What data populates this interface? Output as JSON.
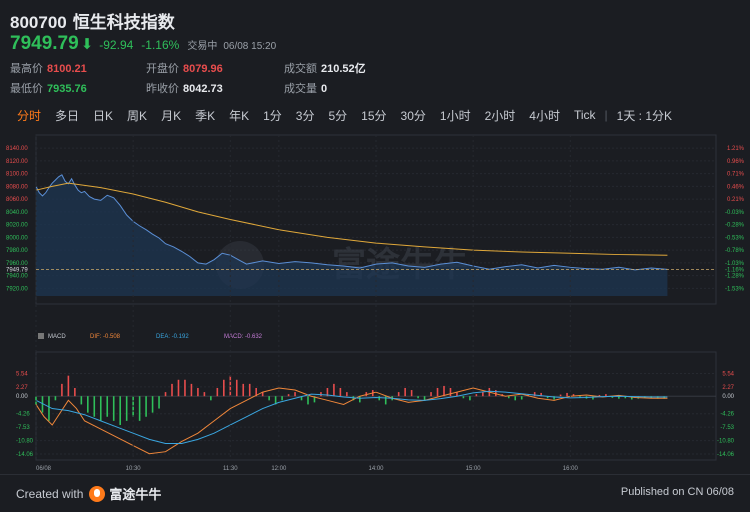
{
  "header": {
    "code": "800700",
    "name": "恒生科技指数",
    "price": "7949.79",
    "change": "-92.94",
    "change_pct": "-1.16%",
    "status": "交易中",
    "datetime": "06/08 15:20",
    "high_label": "最高价",
    "high": "8100.21",
    "low_label": "最低价",
    "low": "7935.76",
    "open_label": "开盘价",
    "open": "8079.96",
    "prev_label": "昨收价",
    "prev": "8042.73",
    "turnover_label": "成交额",
    "turnover": "210.52亿",
    "volume_label": "成交量",
    "volume": "0"
  },
  "tabs": [
    "分时",
    "多日",
    "日K",
    "周K",
    "月K",
    "季K",
    "年K",
    "1分",
    "3分",
    "5分",
    "15分",
    "30分",
    "1小时",
    "2小时",
    "4小时",
    "Tick"
  ],
  "tab_extra": "1天 : 1分K",
  "watermark": "富途牛牛",
  "macd_legend": {
    "name": "MACD",
    "dif": "DIF: -0.508",
    "dea": "DEA: -0.192",
    "macd": "MACD: -0.632"
  },
  "footer": {
    "created": "Created with",
    "brand": "富途牛牛",
    "published": "Published on CN 06/08"
  },
  "colors": {
    "up": "#e84d4d",
    "down": "#2fbf5a",
    "price_line": "#5b8fd6",
    "avg_line": "#e0a83a",
    "dif": "#f0873a",
    "dea": "#3aa6e0",
    "active_tab": "#ff7a1a"
  },
  "chart_data": {
    "type": "line",
    "price_axis": {
      "ticks": [
        "8140.00",
        "8120.00",
        "8100.00",
        "8080.00",
        "8060.00",
        "8040.00",
        "8020.00",
        "8000.00",
        "7980.00",
        "7960.00",
        "7949.79",
        "7940.00",
        "7920.00"
      ],
      "ylim": [
        7908,
        8148
      ]
    },
    "pct_axis": {
      "ticks": [
        "1.21%",
        "0.96%",
        "0.71%",
        "0.46%",
        "0.21%",
        "-0.03%",
        "-0.28%",
        "-0.53%",
        "-0.78%",
        "-1.03%",
        "-1.16%",
        "-1.28%",
        "-1.53%"
      ]
    },
    "time_ticks": [
      "06/08",
      "10:30",
      "11:30",
      "12:00",
      "14:00",
      "15:00",
      "16:00"
    ],
    "price": {
      "name": "price",
      "t": [
        0,
        2,
        4,
        6,
        8,
        10,
        12,
        14,
        16,
        18,
        20,
        22,
        24,
        26,
        28,
        30,
        33,
        36,
        40,
        44,
        48,
        52,
        56,
        60,
        64,
        68,
        72,
        76,
        80,
        85,
        90,
        95,
        100,
        105,
        110,
        115,
        120,
        125,
        130,
        140,
        150,
        160,
        170,
        180,
        190,
        200,
        210,
        220,
        230,
        240,
        250,
        260,
        270,
        280,
        290,
        300,
        310,
        320,
        330,
        340,
        350,
        360,
        370,
        380,
        390
      ],
      "v": [
        8080,
        8070,
        8065,
        8070,
        8078,
        8085,
        8090,
        8095,
        8098,
        8088,
        8084,
        8092,
        8082,
        8074,
        8070,
        8072,
        8064,
        8060,
        8058,
        8066,
        8062,
        8050,
        8035,
        8025,
        8018,
        8012,
        8005,
        7999,
        7990,
        7985,
        7978,
        7970,
        7960,
        7958,
        7965,
        7975,
        7972,
        7965,
        7958,
        7963,
        7959,
        7962,
        7960,
        7957,
        7955,
        7952,
        7958,
        7960,
        7955,
        7953,
        7958,
        7961,
        7955,
        7950,
        7954,
        7957,
        7952,
        7956,
        7953,
        7951,
        7950,
        7953,
        7949,
        7952,
        7949.79
      ]
    },
    "average": {
      "name": "average",
      "t": [
        0,
        10,
        20,
        40,
        60,
        80,
        100,
        120,
        150,
        180,
        210,
        240,
        270,
        300,
        330,
        360,
        390
      ],
      "v": [
        8074,
        8080,
        8085,
        8078,
        8068,
        8055,
        8040,
        8028,
        8012,
        8000,
        7991,
        7985,
        7980,
        7977,
        7975,
        7973,
        7972
      ]
    },
    "macd_axis": {
      "ticks": [
        "5.54",
        "2.27",
        "0.00",
        "-4.26",
        "-7.53",
        "-10.80",
        "-14.06"
      ],
      "ylim": [
        -14.06,
        8.81
      ]
    },
    "dif": {
      "t": [
        0,
        5,
        10,
        15,
        20,
        25,
        30,
        40,
        50,
        60,
        70,
        80,
        90,
        100,
        110,
        120,
        130,
        140,
        150,
        160,
        170,
        180,
        190,
        200,
        210,
        220,
        230,
        240,
        250,
        260,
        270,
        280,
        290,
        300,
        310,
        320,
        330,
        340,
        350,
        360,
        370,
        380,
        390
      ],
      "v": [
        -2,
        -5,
        -7,
        -4,
        -1,
        -3,
        -6,
        -8,
        -10,
        -12,
        -14,
        -13.5,
        -11,
        -9,
        -6,
        -3,
        -1,
        1,
        2,
        1.5,
        0,
        -1,
        -2,
        0,
        1,
        -0.5,
        -1.5,
        -1,
        0,
        1,
        2,
        1,
        0,
        0.5,
        -0.5,
        -1,
        0,
        0.3,
        -0.2,
        0.2,
        -0.3,
        -0.5,
        -0.5
      ]
    },
    "dea": {
      "t": [
        0,
        10,
        20,
        30,
        40,
        50,
        60,
        70,
        80,
        90,
        100,
        110,
        120,
        130,
        140,
        150,
        160,
        170,
        180,
        190,
        200,
        210,
        220,
        230,
        240,
        250,
        260,
        270,
        280,
        290,
        300,
        310,
        320,
        330,
        340,
        350,
        360,
        370,
        380,
        390
      ],
      "v": [
        -1,
        -3,
        -3.5,
        -4.5,
        -6,
        -7.5,
        -9,
        -10.5,
        -11.5,
        -11.5,
        -10.5,
        -9,
        -7,
        -5,
        -3,
        -1.5,
        -0.5,
        0.5,
        0.3,
        -0.2,
        -0.5,
        -0.3,
        -0.5,
        -0.9,
        -1,
        -0.6,
        0,
        0.8,
        1.2,
        1,
        0.6,
        0.2,
        -0.2,
        -0.4,
        -0.3,
        -0.1,
        0,
        -0.1,
        -0.2,
        -0.2
      ]
    },
    "macd_bars": {
      "t": [
        0,
        4,
        8,
        12,
        16,
        20,
        24,
        28,
        32,
        36,
        40,
        44,
        48,
        52,
        56,
        60,
        64,
        68,
        72,
        76,
        80,
        84,
        88,
        92,
        96,
        100,
        104,
        108,
        112,
        116,
        120,
        124,
        128,
        132,
        136,
        140,
        144,
        148,
        152,
        156,
        160,
        164,
        168,
        172,
        176,
        180,
        184,
        188,
        192,
        196,
        200,
        204,
        208,
        212,
        216,
        220,
        224,
        228,
        232,
        236,
        240,
        244,
        248,
        252,
        256,
        260,
        264,
        268,
        272,
        276,
        280,
        284,
        288,
        292,
        296,
        300,
        304,
        308,
        312,
        316,
        320,
        324,
        328,
        332,
        336,
        340,
        344,
        348,
        352,
        356,
        360,
        364,
        368,
        372,
        376,
        380,
        384,
        388
      ],
      "v": [
        -2,
        -4,
        -6,
        -1,
        3,
        5,
        2,
        -2,
        -4,
        -5,
        -6,
        -5,
        -6,
        -7,
        -6,
        -5,
        -6,
        -5,
        -4,
        -3,
        1,
        3,
        4,
        4,
        3,
        2,
        1,
        -1,
        2,
        4,
        5,
        4,
        3,
        3,
        2,
        1,
        -1,
        -2,
        -1,
        0.5,
        1,
        -1,
        -2,
        -1.5,
        1,
        2,
        3,
        2,
        1,
        -1,
        -1.5,
        1,
        1.5,
        -1,
        -2,
        -1,
        1,
        2,
        1.5,
        -0.5,
        -1,
        1,
        2,
        2.5,
        2,
        1,
        -0.5,
        -1,
        0.5,
        1,
        2,
        1.5,
        0.5,
        -0.5,
        -1,
        -0.8,
        0.5,
        1,
        0.8,
        -0.5,
        -0.8,
        0.4,
        0.8,
        0.5,
        -0.3,
        -0.6,
        -0.8,
        0.3,
        0.5,
        -0.4,
        -0.6,
        -0.5,
        -0.8,
        -0.6,
        -0.4,
        -0.5,
        -0.6,
        -0.6
      ]
    }
  }
}
